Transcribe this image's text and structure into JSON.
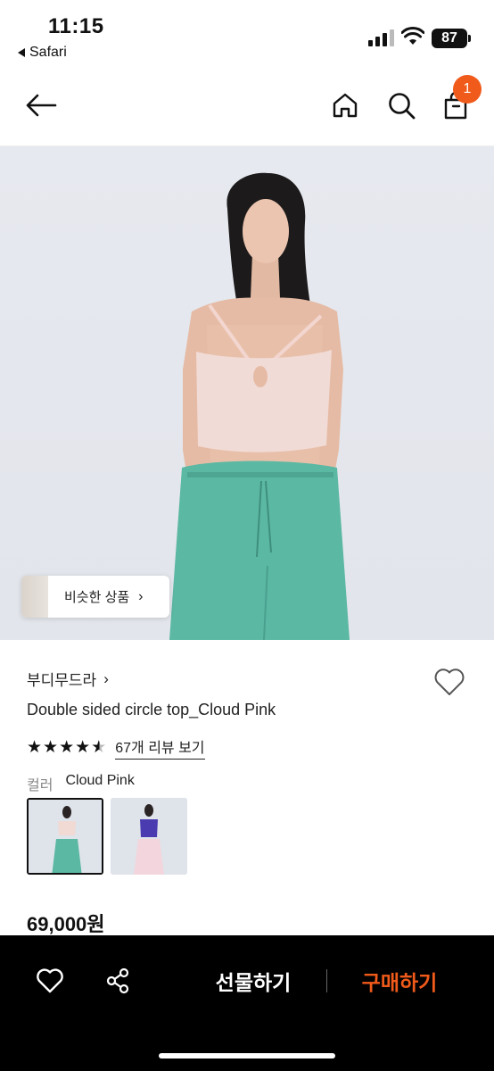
{
  "status_bar": {
    "time": "11:15",
    "back_app": "Safari",
    "battery": "87"
  },
  "nav": {
    "cart_count": "1",
    "icons": [
      "back-arrow-icon",
      "home-icon",
      "search-icon",
      "cart-icon"
    ]
  },
  "product": {
    "similar_label": "비슷한 상품",
    "brand": "부디무드라",
    "title": "Double sided circle top_Cloud Pink",
    "rating": 4.5,
    "review_link": "67개 리뷰 보기",
    "color_label": "컬러",
    "color_value": "Cloud Pink",
    "swatches": [
      {
        "name": "Cloud Pink",
        "top": "#f1d9d4",
        "bottom": "#5bb8a3",
        "selected": true
      },
      {
        "name": "Purple",
        "top": "#4a3bb0",
        "bottom": "#f3d6dd",
        "selected": false
      }
    ],
    "price": "69,000원"
  },
  "bottom_bar": {
    "gift_label": "선물하기",
    "buy_label": "구매하기"
  },
  "colors": {
    "accent": "#f05a1a",
    "bottom_bar": "#000000"
  }
}
